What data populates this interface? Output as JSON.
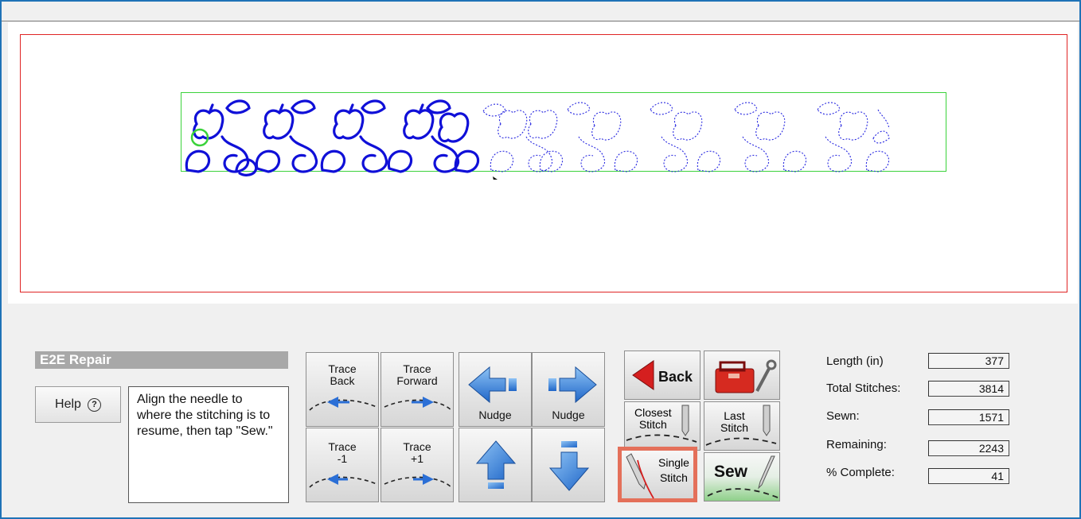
{
  "panel": {
    "title": "E2E Repair",
    "help_label": "Help",
    "help_icon": "question-circle-icon",
    "message": "Align the needle to where the stitching is to resume, then tap \"Sew.\""
  },
  "trace": {
    "back": "Trace\nBack",
    "forward": "Trace\nForward",
    "minus_one": "Trace\n-1",
    "plus_one": "Trace\n+1"
  },
  "nudge": {
    "left_label": "Nudge",
    "right_label": "Nudge"
  },
  "actions": {
    "back_label": "Back",
    "closest_stitch": "Closest\nStitch",
    "last_stitch": "Last\nStitch",
    "single_stitch": "Single\nStitch",
    "sew_label": "Sew"
  },
  "stats": [
    {
      "label": "Length (in)",
      "value": "377"
    },
    {
      "label": "Total Stitches:",
      "value": "3814"
    },
    {
      "label": "Sewn:",
      "value": "1571"
    },
    {
      "label": "Remaining:",
      "value": "2243"
    },
    {
      "label": "% Complete:",
      "value": "41"
    }
  ],
  "colors": {
    "sewn": "#1010d8",
    "unsewn": "#2525e0",
    "boundary": "#e02424",
    "design_box": "#3bd23b",
    "highlight": "#e4705a",
    "frame": "#1f73b7"
  }
}
